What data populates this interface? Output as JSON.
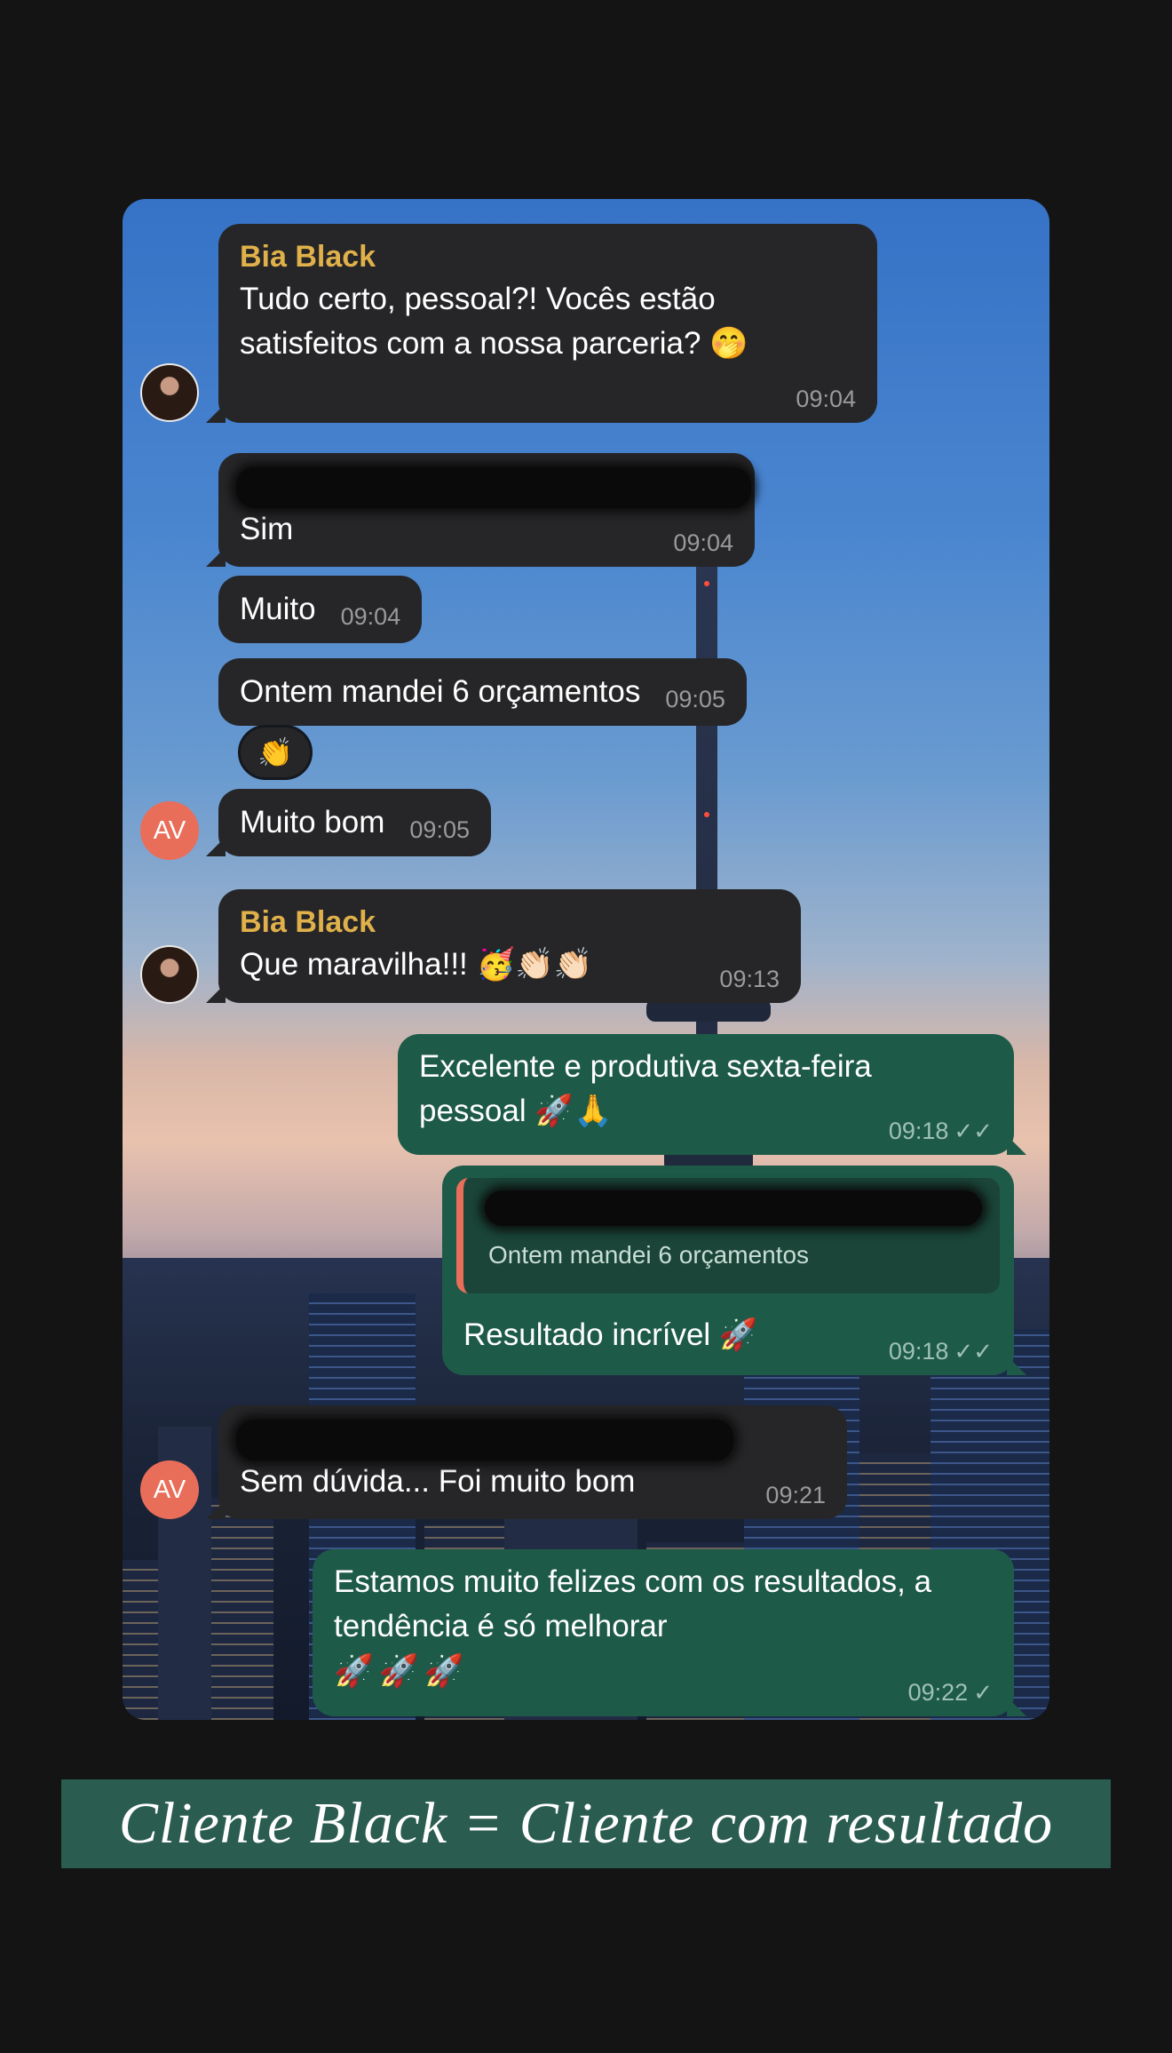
{
  "messages": [
    {
      "sender": "Bia Black",
      "text": "Tudo certo, pessoal?! Vocês estão satisfeitos com a nossa parceria? 🤭",
      "time": "09:04"
    },
    {
      "text": "Sim",
      "time": "09:04"
    },
    {
      "text": "Muito",
      "time": "09:04"
    },
    {
      "text": "Ontem mandei 6 orçamentos",
      "time": "09:05",
      "reaction": "👏"
    },
    {
      "avatar": "AV",
      "text": "Muito bom",
      "time": "09:05"
    },
    {
      "sender": "Bia Black",
      "text": "Que maravilha!!! 🥳👏🏻👏🏻",
      "time": "09:13"
    },
    {
      "text": "Excelente e produtiva sexta-feira pessoal 🚀🙏",
      "time": "09:18",
      "status": "✓✓"
    },
    {
      "quote": "Ontem mandei 6 orçamentos",
      "text": "Resultado incrível 🚀",
      "time": "09:18",
      "status": "✓✓"
    },
    {
      "avatar": "AV",
      "text": "Sem dúvida... Foi muito bom",
      "time": "09:21"
    },
    {
      "text": "Estamos muito felizes com os resultados, a tendência é só melhorar",
      "emojis": "🚀🚀🚀",
      "time": "09:22",
      "status": "✓"
    }
  ],
  "caption": "Cliente Black = Cliente com resultado",
  "colors": {
    "incoming": "#262628",
    "outgoing": "#1e5a48",
    "sender_name": "#e0b14a",
    "avatar_av": "#e96e5a",
    "caption_bg": "#2a5c4f"
  },
  "icons": [
    "avatar-photo",
    "clap-emoji-reaction",
    "double-check-icon",
    "single-check-icon"
  ]
}
